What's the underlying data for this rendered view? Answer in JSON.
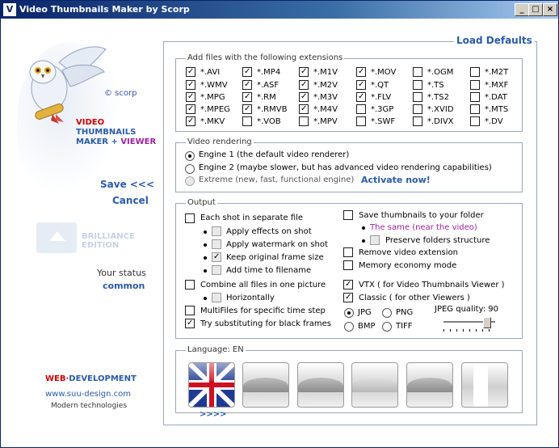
{
  "window": {
    "title": "Video Thumbnails Maker by Scorp",
    "icon_char": "V",
    "minimize": "_",
    "maximize": "□",
    "close": "×"
  },
  "left": {
    "copyright": "© scorp",
    "app_name": {
      "line1": "VIDEO",
      "line2": "THUMBNAILS",
      "line3a": "MAKER + ",
      "line3b": "VIEWER"
    },
    "save_label": "Save <<<",
    "cancel_label": "Cancel",
    "edition_line1": "BRILLIANCE",
    "edition_line2": "EDITION",
    "status_label": "Your status",
    "status_value": "common",
    "web_dev": {
      "part1": "WEB·",
      "part2": "DEVELOPMENT"
    },
    "web_url": "www.suu-design.com",
    "web_tag": "Modern technologies"
  },
  "load_defaults": "Load Defaults",
  "extensions": {
    "title": "Add files with the following extensions",
    "columns": [
      [
        {
          "label": "*.AVI",
          "checked": true
        },
        {
          "label": "*.WMV",
          "checked": true
        },
        {
          "label": "*.MPG",
          "checked": true
        },
        {
          "label": "*.MPEG",
          "checked": true
        },
        {
          "label": "*.MKV",
          "checked": true
        }
      ],
      [
        {
          "label": "*.MP4",
          "checked": true
        },
        {
          "label": "*.ASF",
          "checked": true
        },
        {
          "label": "*.RM",
          "checked": true
        },
        {
          "label": "*.RMVB",
          "checked": true
        },
        {
          "label": "*.VOB",
          "checked": false
        }
      ],
      [
        {
          "label": "*.M1V",
          "checked": true
        },
        {
          "label": "*.M2V",
          "checked": true
        },
        {
          "label": "*.M3V",
          "checked": true
        },
        {
          "label": "*.M4V",
          "checked": true
        },
        {
          "label": "*.MPV",
          "checked": false
        }
      ],
      [
        {
          "label": "*.MOV",
          "checked": true
        },
        {
          "label": "*.QT",
          "checked": true
        },
        {
          "label": "*.FLV",
          "checked": true
        },
        {
          "label": "*.3GP",
          "checked": false
        },
        {
          "label": "*.SWF",
          "checked": false
        }
      ],
      [
        {
          "label": "*.OGM",
          "checked": false
        },
        {
          "label": "*.TS",
          "checked": false
        },
        {
          "label": "*.TS2",
          "checked": false
        },
        {
          "label": "*.XVID",
          "checked": false
        },
        {
          "label": "*.DIVX",
          "checked": false
        }
      ],
      [
        {
          "label": "*.M2T",
          "checked": false
        },
        {
          "label": "*.MXF",
          "checked": false
        },
        {
          "label": "*.DAT",
          "checked": false
        },
        {
          "label": "*.MTS",
          "checked": false
        },
        {
          "label": "*.DV",
          "checked": false
        }
      ]
    ]
  },
  "rendering": {
    "title": "Video rendering",
    "engine1": "Engine 1 (the default video renderer)",
    "engine2": "Engine 2 (maybe slower, but has advanced video rendering capabilities)",
    "extreme": "Extreme (new, fast, functional engine)",
    "activate": "Activate now!"
  },
  "output": {
    "title": "Output",
    "each_shot": "Each shot in separate file",
    "apply_effects": "Apply effects on shot",
    "apply_watermark": "Apply watermark on shot",
    "keep_frame": "Keep original frame size",
    "add_time": "Add time to filename",
    "combine": "Combine all files in one picture",
    "horizontally": "Horizontally",
    "multifiles": "MultiFiles for specific time step",
    "try_subst": "Try substituting for black frames",
    "save_folder": "Save thumbnails to your folder",
    "same_near": "The same (near the video)",
    "preserve": "Preserve folders structure",
    "remove_ext": "Remove video extension",
    "memory": "Memory economy mode",
    "vtx": "VTX ( for Video Thumbnails Viewer )",
    "classic": "Classic ( for other Viewers )",
    "jpg": "JPG",
    "png": "PNG",
    "bmp": "BMP",
    "tiff": "TIFF",
    "jpeg_quality_label": "JPEG quality: 90",
    "jpeg_quality": 90
  },
  "language": {
    "title": "Language: EN",
    "more": ">>>>"
  },
  "colors": {
    "accent": "#2a5aa8",
    "web_red": "#cc0000",
    "purple": "#9c1fa0"
  }
}
